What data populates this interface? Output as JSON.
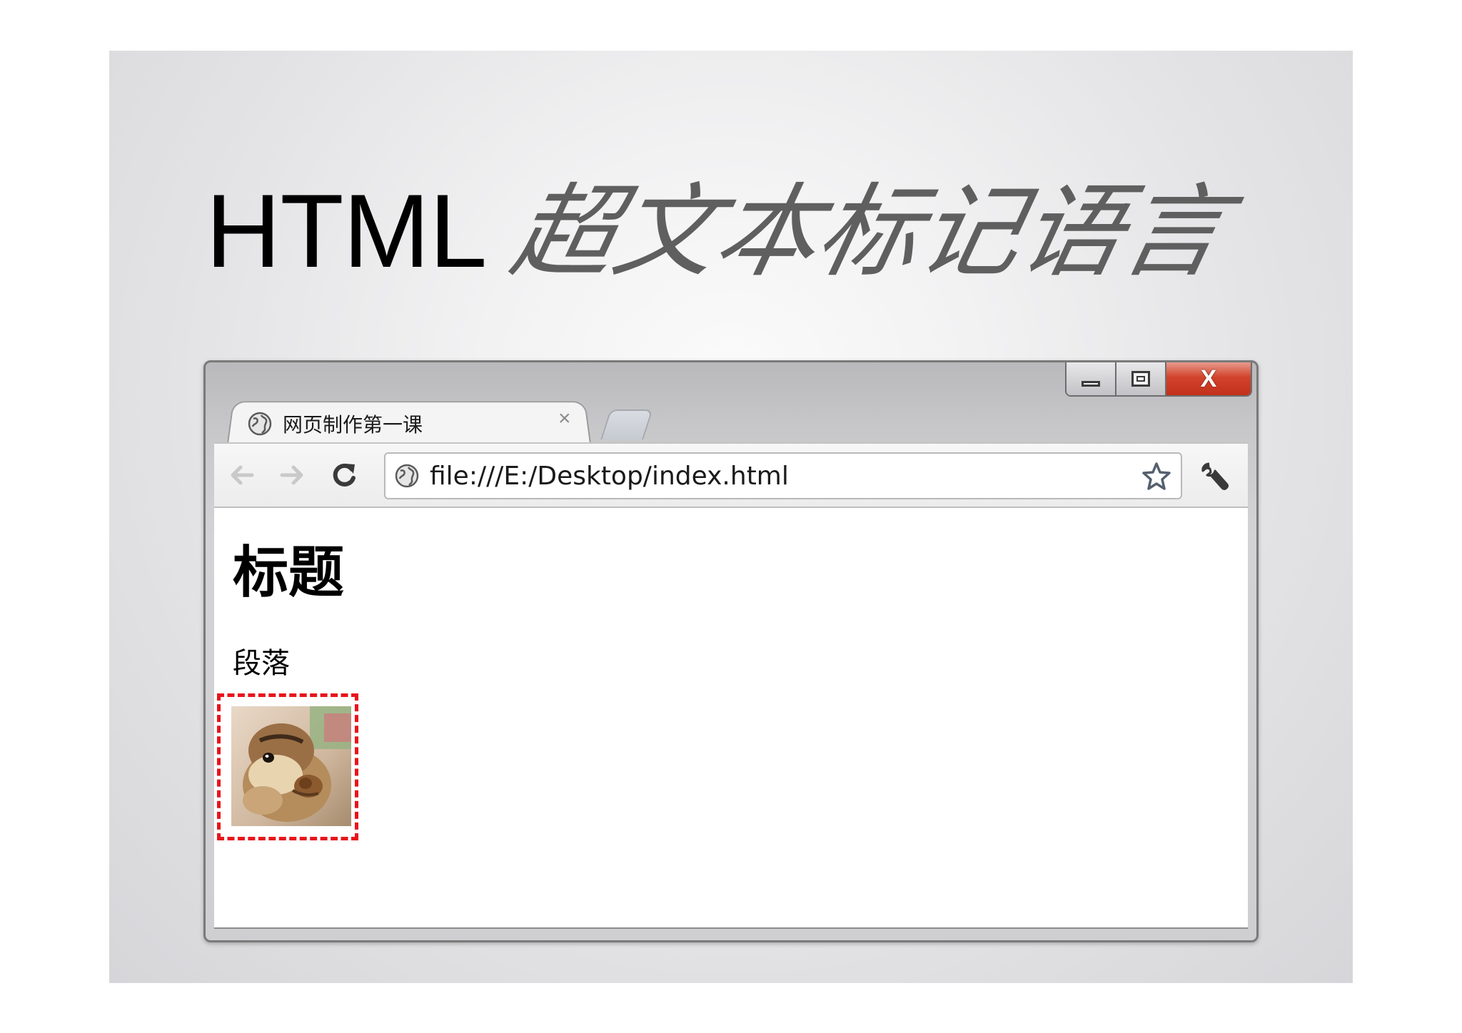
{
  "slide": {
    "title_en": "HTML",
    "title_zh": "超文本标记语言"
  },
  "browser": {
    "tab": {
      "title": "网页制作第一课",
      "close_label": "×"
    },
    "window_controls": {
      "close_label": "X"
    },
    "toolbar": {
      "url": "file:///E:/Desktop/index.html"
    },
    "page": {
      "heading": "标题",
      "paragraph": "段落",
      "image_subject": "chipmunk"
    }
  },
  "colors": {
    "highlight_border": "#e8141b",
    "title_zh": "#5f5f5f",
    "close_button": "#d2432c"
  },
  "icons": {
    "tab_favicon": "globe-icon",
    "back": "back-arrow-icon",
    "forward": "forward-arrow-icon",
    "reload": "reload-icon",
    "omnibox_favicon": "globe-icon",
    "bookmark": "star-icon",
    "menu": "wrench-icon"
  }
}
